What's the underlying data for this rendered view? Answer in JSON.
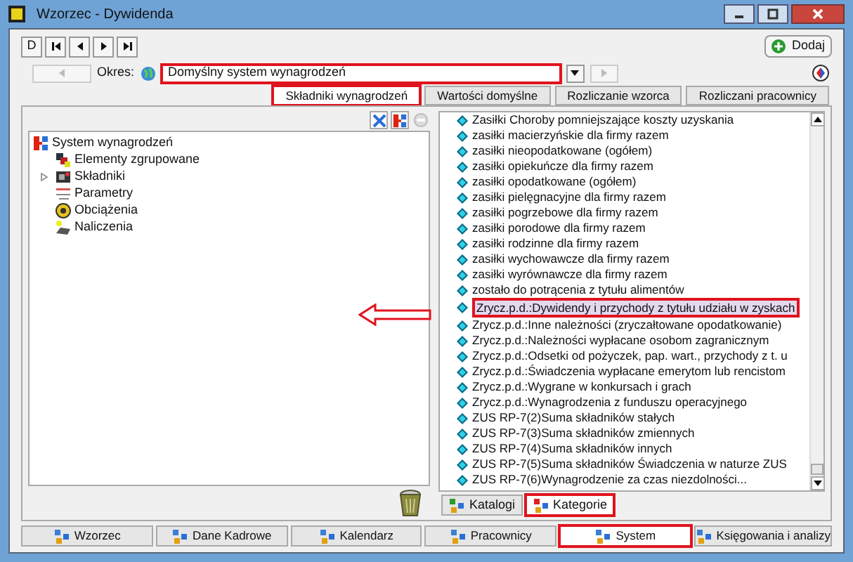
{
  "window": {
    "title": "Wzorzec - Dywidenda"
  },
  "nav_buttons": [
    {
      "label": "D"
    },
    {
      "kind": "first"
    },
    {
      "kind": "prev"
    },
    {
      "kind": "next"
    },
    {
      "kind": "last"
    }
  ],
  "add_button": {
    "label": "Dodaj"
  },
  "period": {
    "label": "Okres:",
    "value": "Domyślny system wynagrodzeń",
    "highlighted": true
  },
  "tabs": [
    {
      "label": "Składniki wynagrodzeń",
      "selected": true
    },
    {
      "label": "Wartości domyślne",
      "selected": false
    },
    {
      "label": "Rozliczanie wzorca",
      "selected": false
    },
    {
      "label": "Rozliczani pracownicy",
      "selected": false
    }
  ],
  "tree": [
    {
      "label": "System wynagrodzeń",
      "kind": "system",
      "children": [
        {
          "label": "Elementy zgrupowane",
          "kind": "group"
        },
        {
          "label": "Składniki",
          "kind": "components",
          "expanded": false
        },
        {
          "label": "Parametry",
          "kind": "params"
        },
        {
          "label": "Obciążenia",
          "kind": "charges"
        },
        {
          "label": "Naliczenia",
          "kind": "accruals"
        }
      ]
    }
  ],
  "list": {
    "items": [
      {
        "label": "Zasiłki Choroby pomniejszające koszty uzyskania",
        "selected": false
      },
      {
        "label": "zasiłki macierzyńskie dla firmy razem",
        "selected": false
      },
      {
        "label": "zasiłki nieopodatkowane (ogółem)",
        "selected": false
      },
      {
        "label": "zasiłki opiekuńcze dla firmy razem",
        "selected": false
      },
      {
        "label": "zasiłki opodatkowane (ogółem)",
        "selected": false
      },
      {
        "label": "zasiłki pielęgnacyjne dla firmy razem",
        "selected": false
      },
      {
        "label": "zasiłki pogrzebowe dla firmy razem",
        "selected": false
      },
      {
        "label": "zasiłki porodowe dla firmy razem",
        "selected": false
      },
      {
        "label": "zasiłki rodzinne dla firmy razem",
        "selected": false
      },
      {
        "label": "zasiłki wychowawcze dla firmy razem",
        "selected": false
      },
      {
        "label": "zasiłki wyrównawcze dla firmy razem",
        "selected": false
      },
      {
        "label": "zostało do potrącenia z tytułu alimentów",
        "selected": false
      },
      {
        "label": "Zrycz.p.d.:Dywidendy i przychody z tytułu udziału w zyskach",
        "selected": true
      },
      {
        "label": "Zrycz.p.d.:Inne należności (zryczałtowane opodatkowanie)",
        "selected": false
      },
      {
        "label": "Zrycz.p.d.:Należności wypłacane osobom zagranicznym",
        "selected": false
      },
      {
        "label": "Zrycz.p.d.:Odsetki od pożyczek, pap. wart., przychody z t. u",
        "selected": false
      },
      {
        "label": "Zrycz.p.d.:Świadczenia wypłacane emerytom lub rencistom",
        "selected": false
      },
      {
        "label": "Zrycz.p.d.:Wygrane w konkursach i grach",
        "selected": false
      },
      {
        "label": "Zrycz.p.d.:Wynagrodzenia z funduszu operacyjnego",
        "selected": false
      },
      {
        "label": "ZUS RP-7(2)Suma składników stałych",
        "selected": false
      },
      {
        "label": "ZUS RP-7(3)Suma składników zmiennych",
        "selected": false
      },
      {
        "label": "ZUS RP-7(4)Suma składników innych",
        "selected": false
      },
      {
        "label": "ZUS RP-7(5)Suma składników Świadczenia w naturze ZUS",
        "selected": false
      },
      {
        "label": "ZUS RP-7(6)Wynagrodzenie za czas niezdolności...",
        "selected": false
      }
    ]
  },
  "list_tabs": [
    {
      "label": "Katalogi",
      "selected": false
    },
    {
      "label": "Kategorie",
      "selected": true
    }
  ],
  "bottom_nav": [
    {
      "label": "Wzorzec",
      "selected": false
    },
    {
      "label": "Dane Kadrowe",
      "selected": false
    },
    {
      "label": "Kalendarz",
      "selected": false
    },
    {
      "label": "Pracownicy",
      "selected": false
    },
    {
      "label": "System",
      "selected": true
    },
    {
      "label": "Księgowania i analizy",
      "selected": false
    }
  ]
}
